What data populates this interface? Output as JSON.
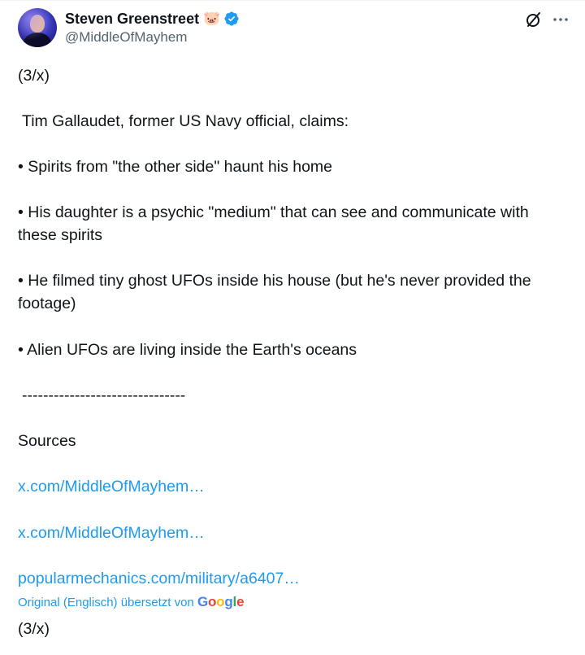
{
  "author": {
    "display_name": "Steven Greenstreet",
    "emoji": "🐷",
    "handle": "@MiddleOfMayhem"
  },
  "icons": {
    "avatar": "avatar",
    "verified": "verified-badge-icon",
    "grok": "grok-icon",
    "more": "more-options-icon"
  },
  "colors": {
    "link": "#1d9bf0",
    "text": "#0f1419",
    "muted": "#536471",
    "verified": "#1d9bf0"
  },
  "body": {
    "part_marker": "(3/x)",
    "intro": "Tim Gallaudet, former US Navy official, claims:",
    "bullet_1": "• Spirits from \"the other side\" haunt his home",
    "bullet_2_line_1": "• His daughter is a psychic \"medium\" that can see and communicate with",
    "bullet_2_line_2": "these spirits",
    "bullet_3_line_1": "• He filmed tiny ghost UFOs inside his house (but he's never provided the",
    "bullet_3_line_2": "footage)",
    "bullet_4": "• Alien UFOs are living inside the Earth's oceans",
    "divider": "-------------------------------",
    "sources_label": "Sources",
    "link_1": "x.com/MiddleOfMayhem…",
    "link_2": "x.com/MiddleOfMayhem…",
    "link_3": "popularmechanics.com/military/a6407…",
    "translated_by": "Original (Englisch) übersetzt von",
    "google_letters": [
      "G",
      "o",
      "o",
      "g",
      "l",
      "e"
    ],
    "google_colors": [
      "#4285F4",
      "#EA4335",
      "#FBBC05",
      "#4285F4",
      "#34A853",
      "#EA4335"
    ],
    "part_marker_end": "(3/x)"
  }
}
